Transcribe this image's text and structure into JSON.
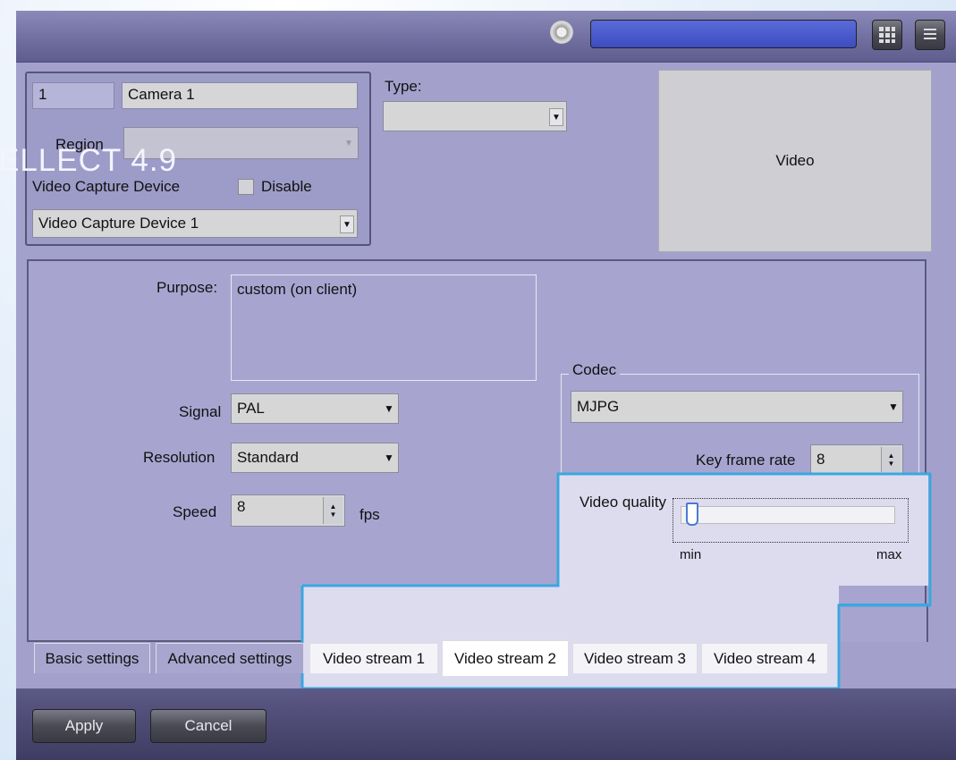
{
  "branding": {
    "watermark": "ELLECT 4.9"
  },
  "toolbar": {
    "search_value": "",
    "icons": [
      "camera-lens-icon",
      "grid-layout-icon",
      "menu-list-icon"
    ]
  },
  "camera": {
    "id": "1",
    "name": "Camera 1",
    "region_label": "Region",
    "region_value": "",
    "capture_device_label": "Video Capture Device",
    "disable_label": "Disable",
    "disable_checked": false,
    "capture_device_value": "Video Capture Device 1"
  },
  "type": {
    "label": "Type:",
    "value": ""
  },
  "video_preview": {
    "label": "Video"
  },
  "settings": {
    "purpose_label": "Purpose:",
    "purpose_value": "custom (on client)",
    "signal_label": "Signal",
    "signal_value": "PAL",
    "resolution_label": "Resolution",
    "resolution_value": "Standard",
    "speed_label": "Speed",
    "speed_value": "8",
    "speed_unit": "fps",
    "codec_label": "Codec",
    "codec_value": "MJPG",
    "key_frame_rate_label": "Key frame rate",
    "key_frame_rate_value": "8",
    "video_quality_label": "Video quality",
    "video_quality_level": 0.0,
    "slider_min": "min",
    "slider_max": "max"
  },
  "tabs": [
    {
      "label": "Basic settings",
      "active": false
    },
    {
      "label": "Advanced settings",
      "active": false
    },
    {
      "label": "Video stream 1",
      "active": false
    },
    {
      "label": "Video stream 2",
      "active": true
    },
    {
      "label": "Video stream 3",
      "active": false
    },
    {
      "label": "Video stream 4",
      "active": false
    }
  ],
  "actions": {
    "apply": "Apply",
    "cancel": "Cancel"
  },
  "colors": {
    "accent_highlight": "#3aa7e0",
    "panel": "#a3a1cc",
    "bar": "#4e4c76"
  }
}
